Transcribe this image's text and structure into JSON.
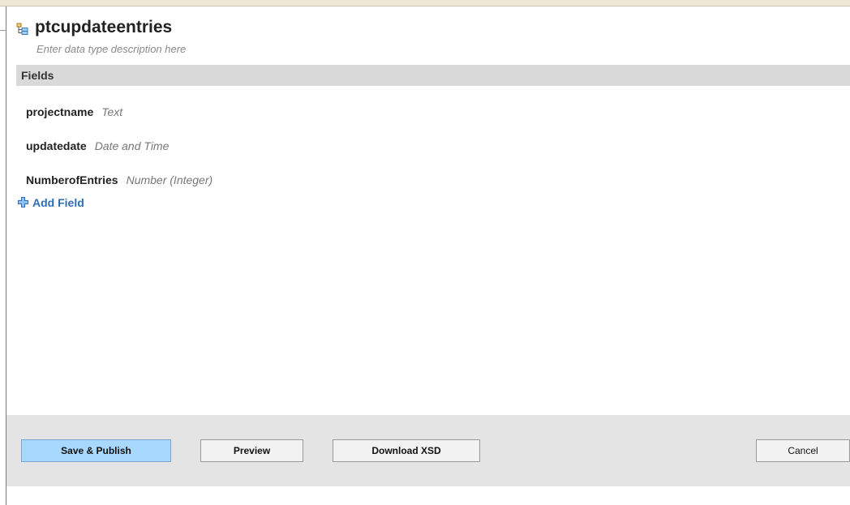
{
  "datatype": {
    "name": "ptcupdateentries",
    "description_placeholder": "Enter data type description here"
  },
  "fields_section": {
    "header": "Fields",
    "fields": [
      {
        "name": "projectname",
        "type": "Text"
      },
      {
        "name": "updatedate",
        "type": "Date and Time"
      },
      {
        "name": "NumberofEntries",
        "type": "Number (Integer)"
      }
    ],
    "add_label": "Add Field"
  },
  "footer": {
    "save_label": "Save & Publish",
    "preview_label": "Preview",
    "download_label": "Download XSD",
    "cancel_label": "Cancel"
  },
  "colors": {
    "accent_link": "#2f6db3",
    "primary_button": "#a9d8ff"
  }
}
